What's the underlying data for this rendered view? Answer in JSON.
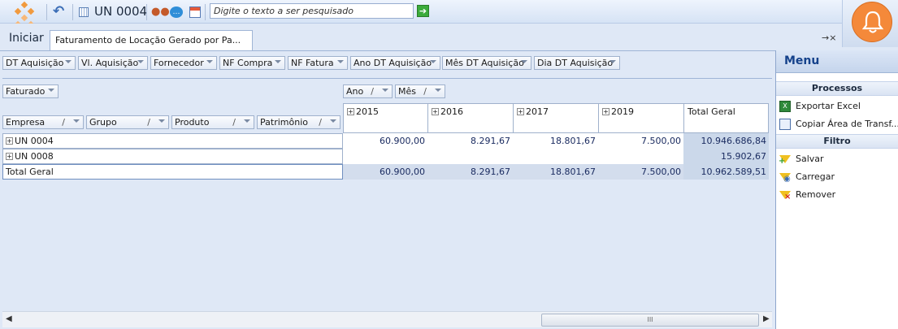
{
  "toolbar": {
    "unit": "UN 0004",
    "search_placeholder": "Digite o texto a ser pesquisado",
    "icons": [
      "logo-icon",
      "undo-icon",
      "grid-icon",
      "people-icon",
      "chat-icon",
      "calendar-icon",
      "go-icon",
      "bell-icon"
    ]
  },
  "tabs": {
    "home": "Iniciar",
    "active": "Faturamento de Locação Gerado por Pa...",
    "controls": "→×"
  },
  "filter_fields": [
    "DT Aquisição",
    "Vl. Aquisição",
    "Fornecedor",
    "NF Compra",
    "NF Fatura",
    "Ano DT Aquisição",
    "Mês DT Aquisição",
    "Dia DT Aquisição"
  ],
  "data_field": "Faturado",
  "column_fields": [
    "Ano",
    "Mês"
  ],
  "row_fields": [
    "Empresa",
    "Grupo",
    "Produto",
    "Patrimônio"
  ],
  "columns": [
    "2015",
    "2016",
    "2017",
    "2019",
    "Total Geral"
  ],
  "rows": [
    {
      "label": "UN 0004",
      "values": [
        "60.900,00",
        "8.291,67",
        "18.801,67",
        "7.500,00",
        "10.946.686,84"
      ]
    },
    {
      "label": "UN 0008",
      "values": [
        "",
        "",
        "",
        "",
        "15.902,67"
      ]
    }
  ],
  "total": {
    "label": "Total Geral",
    "values": [
      "60.900,00",
      "8.291,67",
      "18.801,67",
      "7.500,00",
      "10.962.589,51"
    ]
  },
  "scroll_thumb": "III",
  "menu": {
    "title": "Menu",
    "processos": "Processos",
    "exportar": "Exportar Excel",
    "copiar": "Copiar Área de Transf...",
    "filtro": "Filtro",
    "salvar": "Salvar",
    "carregar": "Carregar",
    "remover": "Remover"
  },
  "colors": {
    "accent": "#f4893a",
    "header": "#15428b",
    "total_bg": "#cbd8ea"
  }
}
